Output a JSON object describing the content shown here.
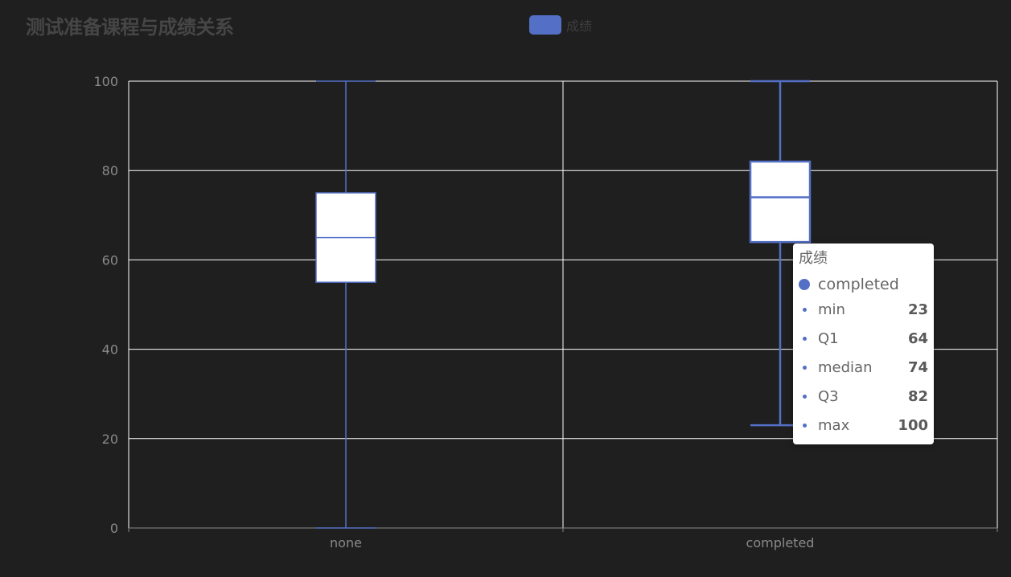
{
  "title": "测试准备课程与成绩关系",
  "legend": {
    "label": "成绩",
    "color": "#5470c6"
  },
  "chart_data": {
    "type": "boxplot",
    "title": "测试准备课程与成绩关系",
    "categories": [
      "none",
      "completed"
    ],
    "series": [
      {
        "name": "成绩",
        "boxes": [
          {
            "category": "none",
            "min": 0,
            "q1": 55,
            "median": 65,
            "q3": 75,
            "max": 100
          },
          {
            "category": "completed",
            "min": 23,
            "q1": 64,
            "median": 74,
            "q3": 82,
            "max": 100
          }
        ]
      }
    ],
    "ylim": [
      0,
      100
    ],
    "yticks": [
      0,
      20,
      40,
      60,
      80,
      100
    ],
    "grid": true,
    "legend_position": "top-center"
  },
  "colors": {
    "series": "#5470c6",
    "box_fill": "#ffffff",
    "grid": "#ffffff",
    "axis": "#8a8a8a",
    "background": "#1f1f1f"
  },
  "tooltip": {
    "title": "成绩",
    "series_name": "completed",
    "rows": [
      {
        "label": "min",
        "value": "23"
      },
      {
        "label": "Q1",
        "value": "64"
      },
      {
        "label": "median",
        "value": "74"
      },
      {
        "label": "Q3",
        "value": "82"
      },
      {
        "label": "max",
        "value": "100"
      }
    ]
  }
}
